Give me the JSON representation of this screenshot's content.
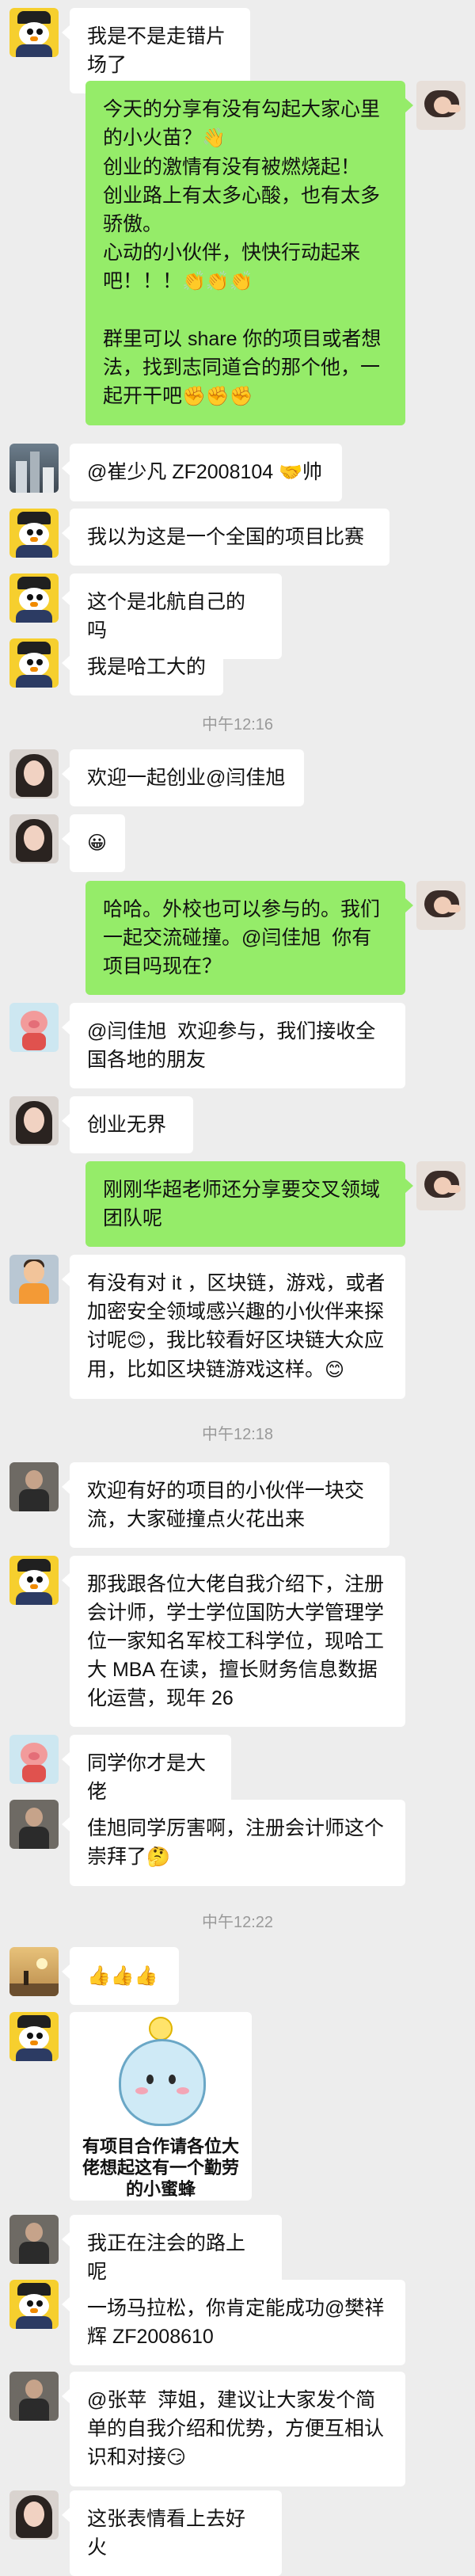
{
  "messages": [
    {
      "text": "我是不是走错片场了"
    },
    {
      "text": "今天的分享有没有勾起大家心里的小火苗？",
      "emoji": "👋"
    },
    {
      "text": "创业的激情有没有被燃烧起！"
    },
    {
      "text": "创业路上有太多心酸，也有太多骄傲。"
    },
    {
      "text": "心动的小伙伴，快快行动起来吧！！！",
      "emoji": "👏👏👏"
    },
    {
      "text": "群里可以 share 你的项目或者想法，找到志同道合的那个他，一起开干吧",
      "emoji": "✊✊✊"
    },
    {
      "text": "@崔少凡 ZF2008104 ",
      "emoji": "🤝",
      "suffix": "帅"
    },
    {
      "text": "我以为这是一个全国的项目比赛"
    },
    {
      "text": "这个是北航自己的吗"
    },
    {
      "text": "我是哈工大的"
    },
    {
      "text": "欢迎一起创业@闫佳旭"
    },
    {
      "text": "",
      "emoji": "😀"
    },
    {
      "text": "哈哈。外校也可以参与的。我们一起交流碰撞。@闫佳旭  你有项目吗现在？"
    },
    {
      "text": "@闫佳旭  欢迎参与，我们接收全国各地的朋友"
    },
    {
      "text": "创业无界"
    },
    {
      "text": "刚刚华超老师还分享要交叉领域团队呢"
    },
    {
      "text": "有没有对 it ，区块链，游戏，或者加密安全领域感兴趣的小伙伴来探讨呢",
      "emoji": "😊",
      "suffix": "，我比较看好区块链大众应用，比如区块链游戏这样。",
      "emoji2": "😊"
    },
    {
      "text": "欢迎有好的项目的小伙伴一块交流，大家碰撞点火花出来"
    },
    {
      "text": "那我跟各位大佬自我介绍下，注册会计师，学士学位国防大学管理学位一家知名军校工科学位，现哈工大 MBA 在读，擅长财务信息数据化运营，现年 26"
    },
    {
      "text": "同学你才是大佬"
    },
    {
      "text": "佳旭同学厉害啊，注册会计师这个崇拜了",
      "emoji": "🤔"
    },
    {
      "text": "",
      "emoji": "👍👍👍"
    },
    {
      "text": "我正在注会的路上呢"
    },
    {
      "text": "一场马拉松，你肯定能成功@樊祥辉 ZF2008610"
    },
    {
      "text": "@张苹  萍姐，建议让大家发个简单的自我介绍和优势，方便互相认识和对接",
      "emoji": "😏"
    },
    {
      "text": "这张表情看上去好火"
    }
  ],
  "timestamps": [
    "中午12:16",
    "中午12:18",
    "中午12:22"
  ],
  "sticker": {
    "line1": "有项目合作请各位大",
    "line2": "佬想起这有一个勤劳",
    "line3": "的小蜜蜂"
  },
  "colors": {
    "background": "#ededed",
    "self_bubble": "#95ec69",
    "other_bubble": "#ffffff",
    "timestamp_text": "#9a9a9a"
  }
}
